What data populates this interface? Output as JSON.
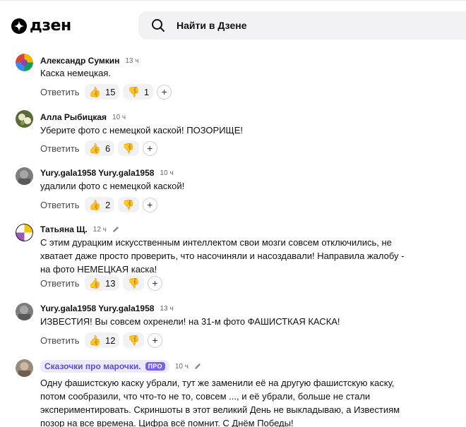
{
  "header": {
    "logo_text": "дзен",
    "search_placeholder": "Найти в Дзене"
  },
  "actions": {
    "reply_label": "Ответить",
    "add_reaction": "+"
  },
  "comments": [
    {
      "author": "Александр Сумкин",
      "time": "13 ч",
      "edited": false,
      "text": "Каска немецкая.",
      "likes": "15",
      "dislikes": "1"
    },
    {
      "author": "Алла Рыбицкая",
      "time": "10 ч",
      "edited": false,
      "text": "Уберите фото с немецкой каской! ПОЗОРИЩЕ!",
      "likes": "6",
      "dislikes": ""
    },
    {
      "author": "Yury.gala1958 Yury.gala1958",
      "time": "10 ч",
      "edited": false,
      "text": "удалили фото с немецкой каской!",
      "likes": "2",
      "dislikes": ""
    },
    {
      "author": "Татьяна Щ.",
      "time": "12 ч",
      "edited": true,
      "text": "С этим дурацким искусственным интеллектом свои мозги совсем отключились, не хватает даже просто проверить, что насочиняли и насоздавали! Направила жалобу - на фото НЕМЕЦКАЯ каска!",
      "likes": "13",
      "dislikes": ""
    },
    {
      "author": "Yury.gala1958 Yury.gala1958",
      "time": "13 ч",
      "edited": false,
      "text": "ИЗВЕСТИЯ! Вы совсем охренели! на 31-м фото ФАШИСТКАЯ КАСКА!",
      "likes": "12",
      "dislikes": ""
    },
    {
      "author": "Сказочки про марочки.",
      "badge": "ПРО",
      "time": "10 ч",
      "edited": true,
      "text": "Одну фашистскую каску убрали, тут же заменили её на другую фашистскую каску, потом сообразили, что что-то не то, совсем ..., и её убрали, больше не стали экспериментировать. Скриншоты в этот великий День не выкладываю, а Известиям позор на все времена. Цифра всё помнит. С Днём Победы!"
    }
  ],
  "icons": {
    "like": "thumbs-up-icon",
    "dislike": "thumbs-down-icon",
    "edit": "pencil-icon",
    "search": "search-icon"
  },
  "colors": {
    "accent_purple": "#5f4bd6",
    "chip_bg": "#ece9fb",
    "button_bg": "#f2f2f4"
  }
}
